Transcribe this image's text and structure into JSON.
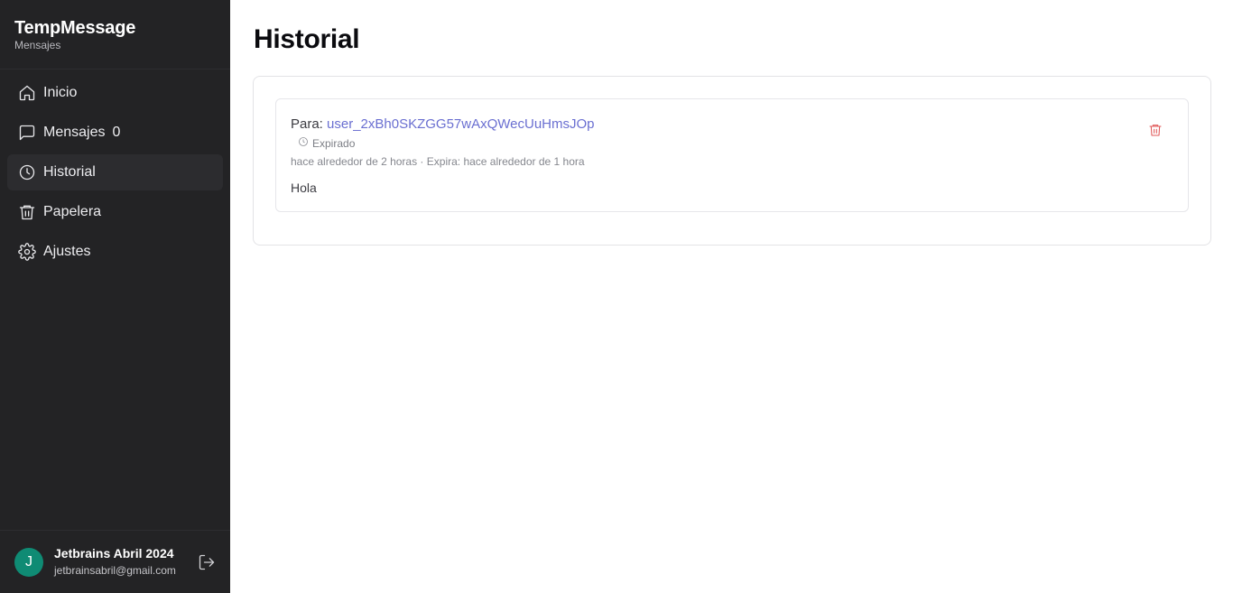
{
  "app": {
    "title": "TempMessage",
    "subtitle": "Mensajes"
  },
  "sidebar": {
    "items": [
      {
        "label": "Inicio",
        "icon": "home-icon"
      },
      {
        "label": "Mensajes",
        "icon": "message-square-icon",
        "count": "0"
      },
      {
        "label": "Historial",
        "icon": "clock-icon",
        "active": true
      },
      {
        "label": "Papelera",
        "icon": "trash-icon"
      },
      {
        "label": "Ajustes",
        "icon": "gear-icon"
      }
    ]
  },
  "user": {
    "initial": "J",
    "name": "Jetbrains Abril 2024",
    "email": "jetbrainsabril@gmail.com",
    "avatar_color": "#0f8b74"
  },
  "main": {
    "title": "Historial",
    "messages": [
      {
        "to_label": "Para:",
        "to_user": "user_2xBh0SKZGG57wAxQWecUuHmsJOp",
        "status": "Expirado",
        "meta": "hace alrededor de 2 horas · Expira: hace alrededor de 1 hora",
        "body": "Hola"
      }
    ]
  },
  "colors": {
    "sidebar_bg": "#232325",
    "link": "#6a6fd1",
    "delete": "#e05a5a"
  }
}
